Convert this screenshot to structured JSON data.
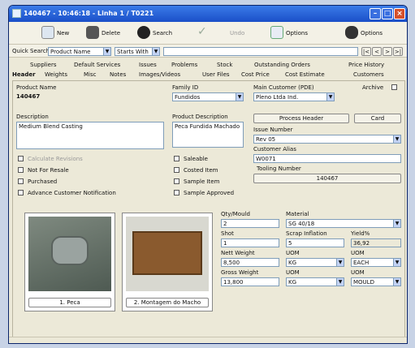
{
  "window": {
    "title": "140467 - 10:46:18 - Linha 1 / T0221"
  },
  "toolbar": {
    "new": "New",
    "delete": "Delete",
    "search": "Search",
    "ok": "",
    "undo": "Undo",
    "options1": "Options",
    "options2": "Options"
  },
  "quick_search": {
    "label": "Quick Search",
    "field": "Product Name",
    "mode": "Starts With",
    "nav": [
      "|<",
      "<",
      ">",
      ">|"
    ]
  },
  "tabs_top": [
    "Suppliers",
    "Default Services",
    "Issues",
    "Problems",
    "Stock",
    "Outstanding Orders",
    "Price History"
  ],
  "tabs_bottom": [
    "Header",
    "Weights",
    "Misc",
    "Notes",
    "Images/Videos",
    "User Files",
    "Cost Price",
    "Cost Estimate",
    "Customers"
  ],
  "form": {
    "product_name_label": "Product Name",
    "product_name": "140467",
    "family_label": "Family ID",
    "family": "Fundidos",
    "main_customer_label": "Main Customer (PDE)",
    "main_customer": "Pleno Ltda Ind.",
    "archive_label": "Archive",
    "description_label": "Description",
    "description": "Medium Blend Casting",
    "product_desc_label": "Product Description",
    "product_desc": "Peca Fundida Machado",
    "process_header_btn": "Process Header",
    "card_btn": "Card",
    "issue_number_label": "Issue Number",
    "issue_number": "Rev 05",
    "customer_alias_label": "Customer Alias",
    "customer_alias": "W0071",
    "tooling_number_label": "Tooling Number",
    "tooling_number": "140467",
    "checks_left": [
      "Calculate Revisions",
      "Not For Resale",
      "Purchased",
      "Advance Customer Notification"
    ],
    "checks_mid": [
      "Saleable",
      "Costed Item",
      "Sample Item",
      "Sample Approved"
    ]
  },
  "images": [
    {
      "caption": "1. Peca"
    },
    {
      "caption": "2. Montagem do Macho"
    }
  ],
  "grid": {
    "qty_label": "Qty/Mould",
    "qty": "2",
    "material_label": "Material",
    "material": "SG 40/18",
    "yield_shot_label": "Shot",
    "yield_shot": "1",
    "scrap_label": "Scrap Inflation",
    "scrap": "5",
    "yield_label": "Yield%",
    "yield": "36,92",
    "nett_label": "Nett Weight",
    "nett": "8,500",
    "uom1_label": "UOM",
    "uom1": "KG",
    "uom2_label": "UOM",
    "uom2": "EACH",
    "gross_label": "Gross Weight",
    "gross": "13,800",
    "uom3_label": "UOM",
    "uom3": "KG",
    "uom4_label": "UOM",
    "uom4": "MOULD"
  }
}
